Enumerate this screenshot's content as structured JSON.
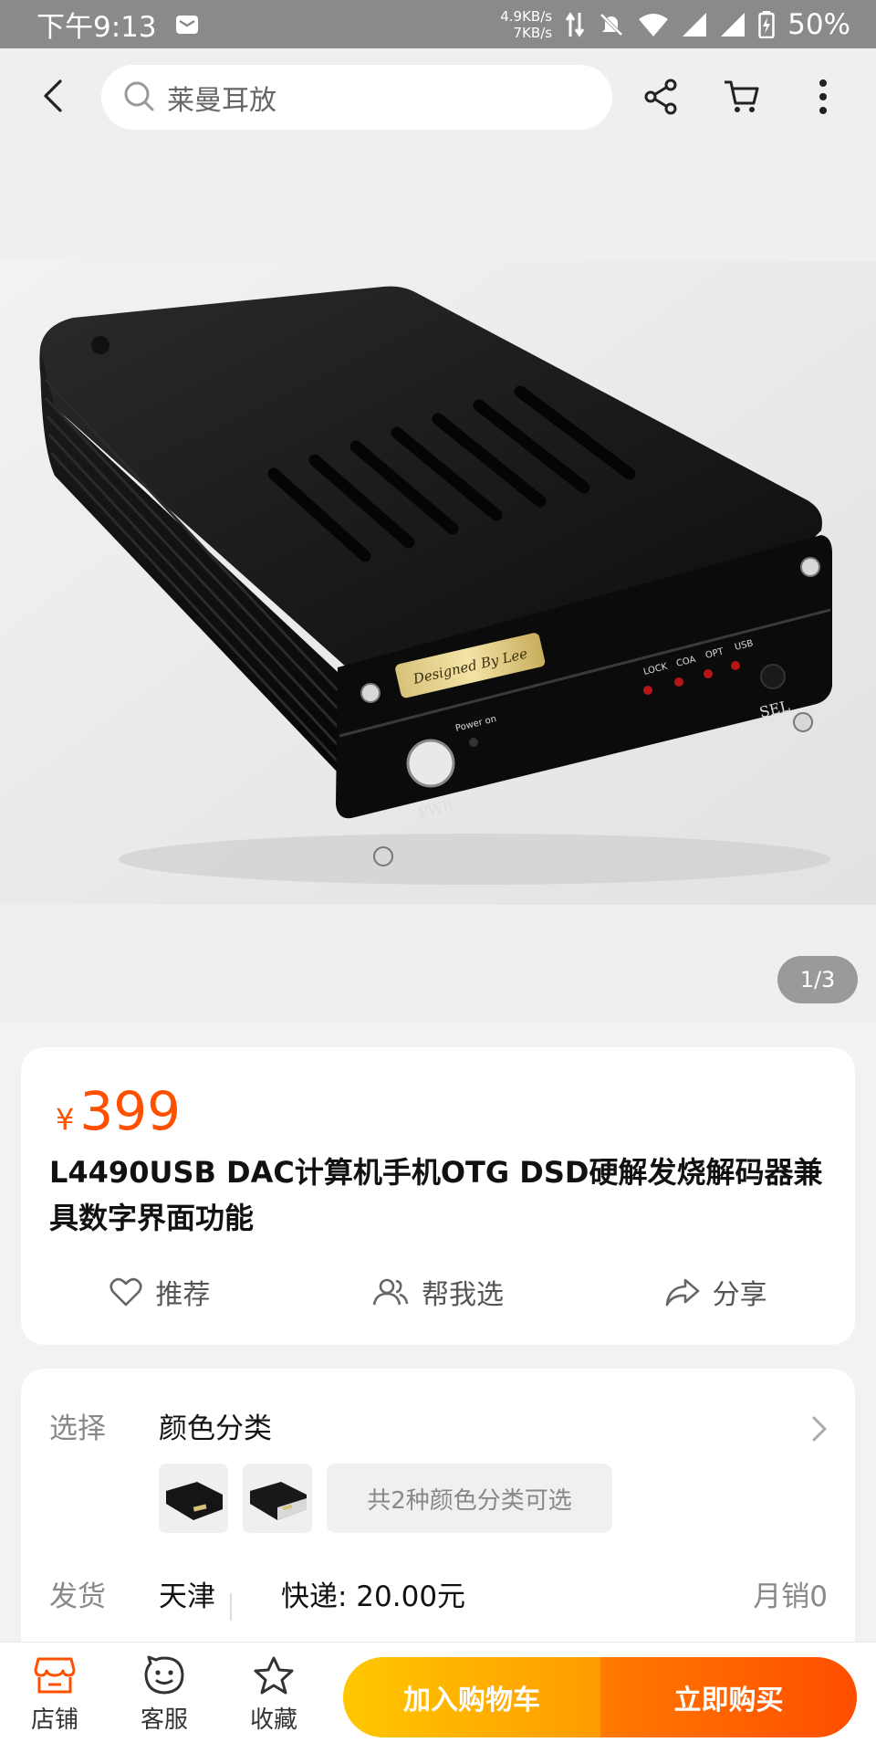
{
  "status_bar": {
    "time": "下午9:13",
    "net_up": "4.9KB/s",
    "net_down": "7KB/s",
    "battery": "50%"
  },
  "header": {
    "search_placeholder": "莱曼耳放",
    "icons": [
      "back-icon",
      "search-icon",
      "share-icon",
      "cart-icon",
      "more-icon"
    ]
  },
  "gallery": {
    "indicator": "1/3",
    "photo_labels": {
      "badge": "Designed By Lee",
      "power": "Power on",
      "pwr": "PWR",
      "sel": "SEL",
      "leds": [
        "LOCK",
        "COA",
        "OPT",
        "USB"
      ]
    }
  },
  "product": {
    "currency": "¥",
    "price": "399",
    "title": "L4490USB DAC计算机手机OTG DSD硬解发烧解码器兼具数字界面功能"
  },
  "actions": {
    "recommend": "推荐",
    "help_choose": "帮我选",
    "share": "分享"
  },
  "sku": {
    "select_label": "选择",
    "select_value": "颜色分类",
    "variants_note": "共2种颜色分类可选",
    "ship_label": "发货",
    "ship_from": "天津",
    "shipping": "快递: 20.00元",
    "monthly_sales": "月销0"
  },
  "bottom_bar": {
    "store": "店铺",
    "service": "客服",
    "favorite": "收藏",
    "add_to_cart": "加入购物车",
    "buy_now": "立即购买"
  },
  "colors": {
    "accent": "#ff5000",
    "cart_gradient": [
      "#ffc700",
      "#ff9b00"
    ],
    "buy_gradient": [
      "#ff7a00",
      "#ff4d00"
    ],
    "status_bar": "#8a8a8a"
  }
}
